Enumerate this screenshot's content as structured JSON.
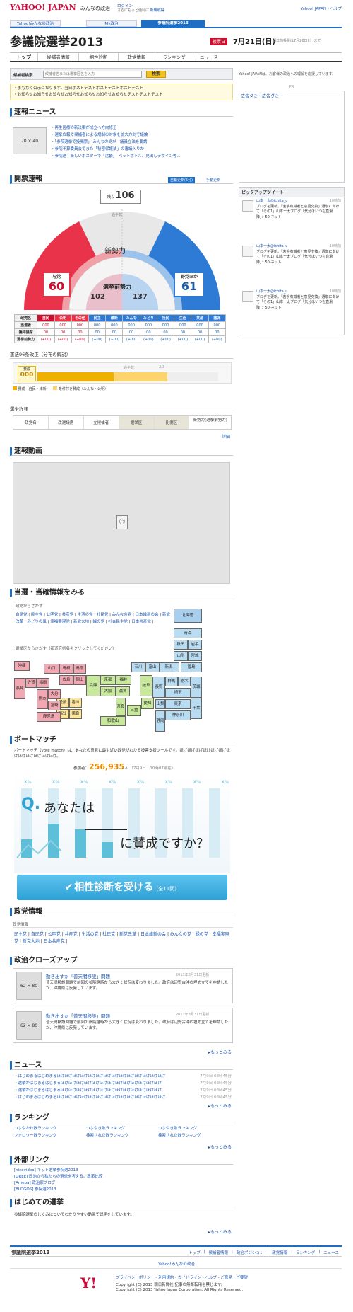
{
  "header": {
    "logo": "YAHOO! JAPAN",
    "site": "みんなの政治",
    "login1": "ログイン",
    "login2": "さらにもっと便利に",
    "register": "新規取得",
    "ytop": "Yahoo! JAPAN - ヘルプ",
    "tabs": [
      "Yahoo!みんなの政治",
      "My政治",
      "参議院選挙2013"
    ]
  },
  "title": {
    "main": "参議院選挙2013",
    "badge": "投票日",
    "date": "7月21日(日)",
    "note": "期日前投票は7月20日(土)まで"
  },
  "nav": [
    "トップ",
    "候補者情報",
    "相性診断",
    "政党情報",
    "ランキング",
    "ニュース"
  ],
  "search": {
    "label": "候補者検索",
    "placeholder": "候補者名または選挙区名を入力",
    "button": "検索",
    "ad_label": "Yahoo! JAPANは、お客様の政治への理解を応援しています。",
    "pr": "PR"
  },
  "notice": [
    "・まもなく公示になります。当日ポストテストポストテストポストテスト",
    "・お知らせお知らせお知らせお知らせお知らせお知らせお知らせテストテストテスト"
  ],
  "news": {
    "title": "速報ニュース",
    "thumb": "70 × 40",
    "items": [
      "・再生医療の新法案が成立へ方向修正",
      "・選挙広報で候補者による規制の対象を拡大方向で議論",
      "・「参院選挙で投開票」 みんなの党が　議員立法を要請",
      "・参院予算委員会でまた「秘密保護法」の審議入りか",
      "・参院選　新しいポスターで「活動」　ペットボトル、見出しデザイン等..."
    ]
  },
  "ad": {
    "label": "広告ダミー広告ダミー"
  },
  "pickup": {
    "title": "ピックアップツイート",
    "tweets": [
      {
        "name": "山本一太@ichita_u",
        "time": "10時前",
        "text": "ブログを更新。「若手有識者と意見交換」選挙に向けて「その1」山本一太ブログ「気分はいつも直滑降」：50-ネット"
      },
      {
        "name": "山本一太@ichita_u",
        "time": "10時前",
        "text": "ブログを更新。「若手有識者と意見交換」選挙に向けて「その1」山本一太ブログ「気分はいつも直滑降」：50-ネット"
      },
      {
        "name": "山本一太@ichita_u",
        "time": "10時前",
        "text": "ブログを更新。「若手有識者と意見交換」選挙に向けて「その1」山本一太ブログ「気分はいつも直滑降」：50-ネット"
      }
    ]
  },
  "count": {
    "title": "開票速報",
    "auto": "自動更新(5分)",
    "manual": "手動更新",
    "remaining_label": "残り",
    "remaining": "106",
    "majority": "過半数",
    "new_force": "新勢力",
    "ruling_label": "与党",
    "ruling": "60",
    "opp_label": "野党ほか",
    "opp": "61",
    "before": "選挙前勢力",
    "before_ruling": "102",
    "before_opp": "137"
  },
  "table": {
    "headers": [
      "政党名",
      "自民",
      "公明",
      "その他",
      "民主",
      "維新",
      "みんな",
      "みどり",
      "社民",
      "生活",
      "共産",
      "諸派"
    ],
    "rows": [
      [
        "当選者",
        "000",
        "000",
        "000",
        "000",
        "000",
        "000",
        "000",
        "000",
        "000",
        "000",
        "000"
      ],
      [
        "獲得議席",
        "00",
        "00",
        "00",
        "00",
        "00",
        "00",
        "00",
        "00",
        "00",
        "00",
        "00"
      ],
      [
        "選挙前勢力",
        "(+00)",
        "(+00)",
        "(+00)",
        "(+00)",
        "(+00)",
        "(+00)",
        "(+00)",
        "(+00)",
        "(+00)",
        "(+00)",
        "(+00)"
      ]
    ]
  },
  "reform": {
    "title": "憲法96条改正（分布の解説）",
    "label": "賛成",
    "value": "000",
    "half": "過半数",
    "two_thirds": "2/3",
    "legend1": "賛成（自民・維新）",
    "legend2": "条件付き賛成（みんな・公明）",
    "fill_ruling": 0.42,
    "fill_cond": 0.3
  },
  "results": {
    "title": "選挙詳報",
    "cols": [
      "政党名",
      "改選議席",
      "立候補者",
      "選挙区",
      "比例区",
      "新勢力(選挙前勢力)"
    ],
    "more": "詳細"
  },
  "video": {
    "title": "速報動画"
  },
  "winners": {
    "title": "当選・当確情報をみる",
    "party_label": "政党からさがす",
    "parties": [
      "自民党",
      "民主党",
      "公明党",
      "共産党",
      "生活の党",
      "社民党",
      "みんなの党",
      "日本維新の会",
      "新党改革",
      "みどりの風",
      "幸福実現党",
      "新党大地",
      "緑の党",
      "社会民主党",
      "日本共産党"
    ],
    "region_label": "選挙区からさがす（都道府県名をクリックしてください）",
    "prefs": [
      "北海道",
      "青森",
      "秋田",
      "岩手",
      "山形",
      "宮城",
      "新潟",
      "石川",
      "富山",
      "福島",
      "群馬",
      "栃木",
      "茨城",
      "長野",
      "埼玉",
      "千葉",
      "東京",
      "神奈川",
      "山梨",
      "静岡",
      "岐阜",
      "愛知",
      "三重",
      "福井",
      "滋賀",
      "京都",
      "奈良",
      "大阪",
      "和歌山",
      "兵庫",
      "鳥取",
      "島根",
      "岡山",
      "広島",
      "山口",
      "香川",
      "愛媛",
      "徳島",
      "高知",
      "福岡",
      "佐賀",
      "長崎",
      "熊本",
      "大分",
      "宮崎",
      "鹿児島",
      "沖縄"
    ]
  },
  "votematch": {
    "title": "ボートマッチ",
    "desc": "ボートマッチ（vote match）は、あなたの意見に最も近い政党がわかる投票支援ツールです。ほげほげほげほげほげほげほげほげほげほげほげほげ。",
    "count_label": "参加者：",
    "count": "256,935",
    "count_unit": "人",
    "count_date": "（7月9日　10時07現在）",
    "q1": "Q.",
    "q2": "あなたは",
    "q3": "に賛成ですか？",
    "button": "相性診断を受ける",
    "button_sub": "（全11問）",
    "marks": [
      "X%",
      "X%",
      "X%",
      "X%",
      "X%",
      "X%",
      "X%",
      "X%",
      "X%"
    ]
  },
  "party": {
    "title": "政党情報",
    "sub": "政党情報",
    "links": [
      "民主党",
      "自民党",
      "公明党",
      "共産党",
      "生活の党",
      "社民党",
      "新党改革",
      "日本維新の会",
      "みんなの党",
      "緑の党",
      "幸福実現党",
      "新党大地",
      "日本共産党"
    ]
  },
  "closeup": {
    "title": "政治クローズアップ",
    "thumb": "62 × 80",
    "items": [
      {
        "title": "動き出すか「普天間移設」問題",
        "date": "2013年3月31日更新",
        "text": "普天間移設問題で前回の参院選時から大きく状況は変わりました。政府は辺野古沖の埋め立てを申請したが、沖縄県は反発しています。"
      },
      {
        "title": "動き出すか「普天間移設」問題",
        "date": "2013年3月31日更新",
        "text": "普天間移設問題で前回の参院選時から大きく状況は変わりました。政府は辺野古沖の埋め立てを申請したが、沖縄県は反発しています。"
      }
    ],
    "more": "もっとみる"
  },
  "news2": {
    "title": "ニュース",
    "items": [
      "・はじめまるはじめまるほげほげほげほげほげほげほげほげほげほげほげほげほげほげ",
      "・選挙がはじまるはじまるほげほげほげほげほげほげほげほげほげほげほげほげほげ",
      "・選挙がはじまるはじまるほげほげほげほげほげほげほげほげほげほげほげほげほげ",
      "・はじめまるはじめまるほげほげほげほげほげほげほげほげほげほげほげほげほげほげ"
    ],
    "dates": [
      "7月9日 08時45分",
      "7月9日 08時45分",
      "7月9日 08時45分",
      "7月9日 08時45分"
    ],
    "more": "もっとみる"
  },
  "ranking": {
    "title": "ランキング",
    "items": [
      "つぶやかれ数ランキング",
      "つぶやき数ランキング",
      "つぶやき数ランキング",
      "フォロワー数ランキング",
      "検索された数ランキング",
      "検索された数ランキング"
    ],
    "more": "もっとみる"
  },
  "links": {
    "title": "外部リンク",
    "items": [
      "[nicovideo] ネット選挙参院選2013",
      "[GREE] 政治から私たちの選挙を考える。政策比較",
      "[Ameba] 政治家ブログ",
      "[BLOGOS] 参院選2013"
    ]
  },
  "first": {
    "title": "はじめての選挙",
    "text": "参議院選挙のしくみについてわかりやすい動画で説明をしています。",
    "more": "もっとみる"
  },
  "footer": {
    "site": "参議院選挙2013",
    "links": [
      "トップ",
      "候補者情報",
      "政治ポジション",
      "政党情報",
      "ランキング",
      "ニュース"
    ],
    "yahoo": "Yahoo!みんなの政治",
    "bottom_links": "プライバシーポリシー - 利用規約 - ガイドライン - ヘルプ - ご意見・ご要望",
    "copy1": "Copyright (C) 2013 朝日新聞社 記事の無断転用を禁じます。",
    "copy2": "Copyright (C) 2013 Yahoo Japan Corporation. All Rights Reserved."
  }
}
